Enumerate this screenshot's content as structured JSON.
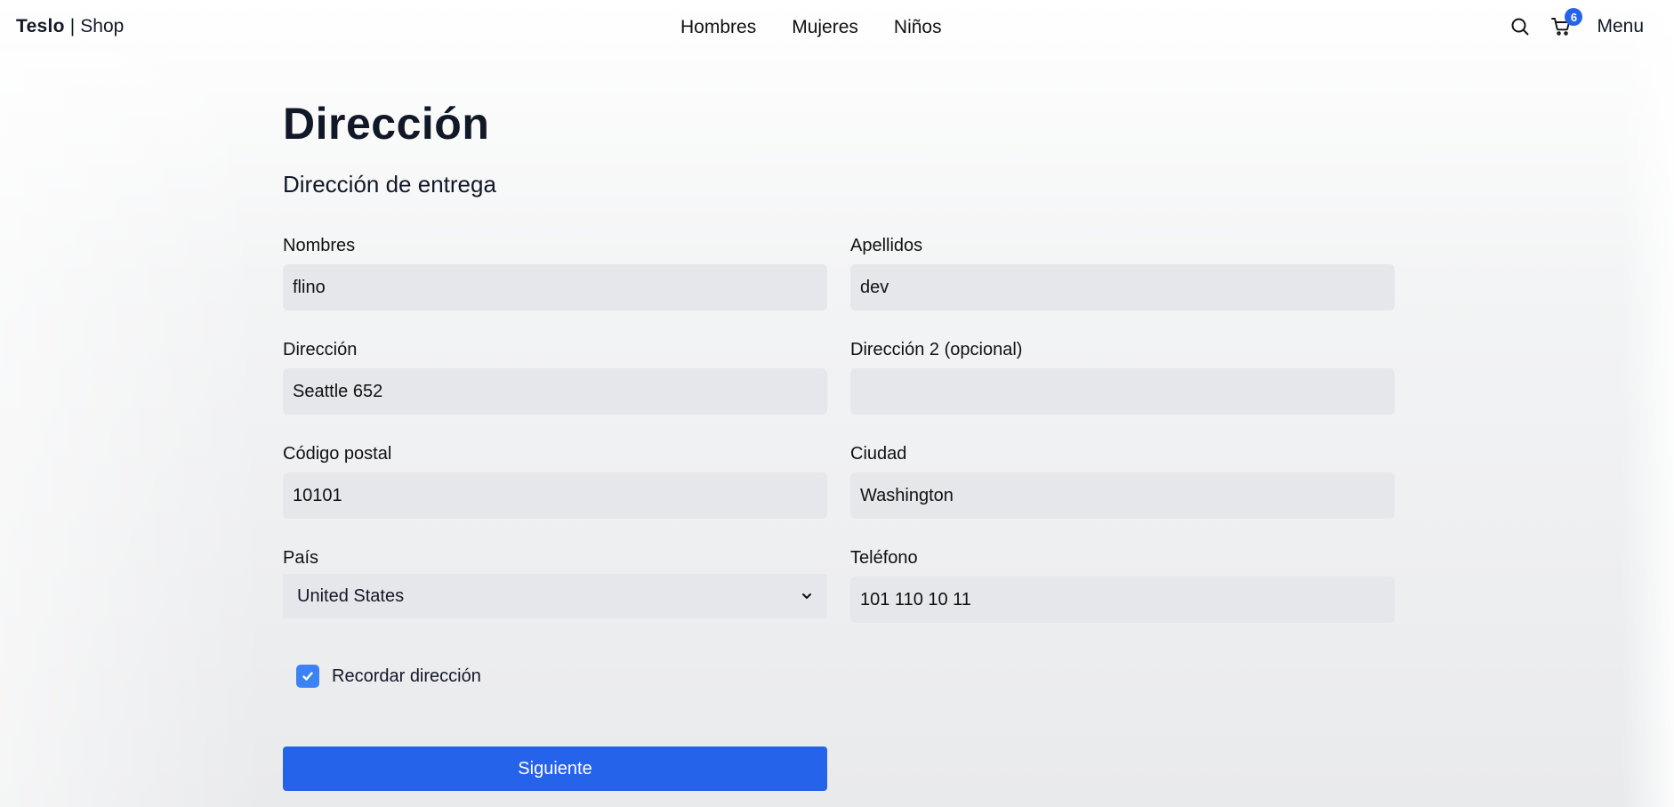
{
  "nav": {
    "brand": "Teslo",
    "brand_separator": "|",
    "brand_suffix": "Shop",
    "links": [
      "Hombres",
      "Mujeres",
      "Niños"
    ],
    "cart_count": "6",
    "menu_label": "Menu",
    "icons": {
      "search": "search-icon",
      "cart": "cart-icon"
    }
  },
  "page": {
    "title": "Dirección",
    "subtitle": "Dirección de entrega"
  },
  "form": {
    "first_name": {
      "label": "Nombres",
      "value": "flino"
    },
    "last_name": {
      "label": "Apellidos",
      "value": "dev"
    },
    "address": {
      "label": "Dirección",
      "value": "Seattle 652"
    },
    "address2": {
      "label": "Dirección 2 (opcional)",
      "value": ""
    },
    "postal_code": {
      "label": "Código postal",
      "value": "10101"
    },
    "city": {
      "label": "Ciudad",
      "value": "Washington"
    },
    "country": {
      "label": "País",
      "selected": "United States"
    },
    "phone": {
      "label": "Teléfono",
      "value": "101 110 10 11"
    },
    "remember": {
      "label": "Recordar dirección",
      "checked": true
    },
    "submit_label": "Siguiente"
  },
  "colors": {
    "accent": "#2563eb",
    "checkbox": "#3b82f6",
    "input_bg": "#e5e7eb"
  }
}
